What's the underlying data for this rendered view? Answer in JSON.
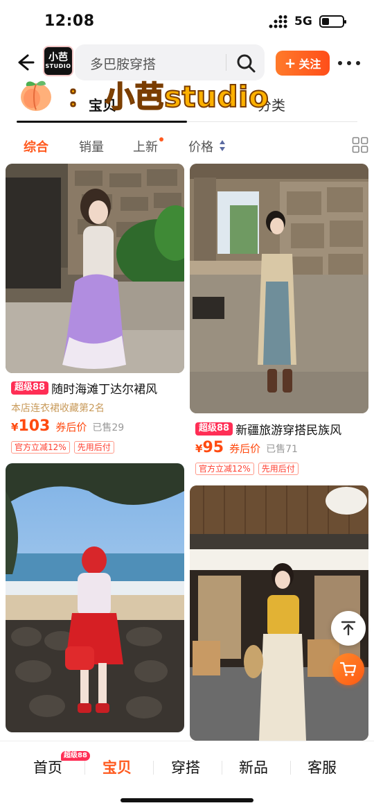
{
  "status_bar": {
    "time": "12:08",
    "network": "5G"
  },
  "header": {
    "shop_logo": {
      "line1": "小芭",
      "line2": "STUDIO"
    },
    "search_text": "多巴胺穿搭",
    "follow_label": "关注",
    "follow_plus": "+"
  },
  "top_tabs": {
    "items": [
      {
        "label": "宝贝"
      },
      {
        "label": "分类"
      }
    ]
  },
  "sticker": {
    "colon": "：",
    "text": "小芭studio"
  },
  "sort_bar": {
    "items": [
      {
        "label": "综合"
      },
      {
        "label": "销量"
      },
      {
        "label": "上新"
      },
      {
        "label": "价格"
      }
    ]
  },
  "products": [
    {
      "badge": "超级88",
      "title": "随时海滩丁达尔裙风",
      "subtitle": "本店连衣裙收藏第2名",
      "currency": "¥",
      "price": "103",
      "price_label": "券后价",
      "sold": "已售29",
      "tags": [
        "官方立减12%",
        "先用后付"
      ]
    },
    {
      "badge": "超级88",
      "title": "新疆旅游穿搭民族风",
      "currency": "¥",
      "price": "95",
      "price_label": "券后价",
      "sold": "已售71",
      "tags": [
        "官方立减12%",
        "先用后付"
      ]
    }
  ],
  "bottom_nav": {
    "badge": "超级88",
    "items": [
      {
        "label": "首页"
      },
      {
        "label": "宝贝"
      },
      {
        "label": "穿搭"
      },
      {
        "label": "新品"
      },
      {
        "label": "客服"
      }
    ]
  },
  "colors": {
    "accent": "#ff5a1f",
    "price": "#ff4a10",
    "badge": "#ff2e55",
    "sticker_fill": "#fdb100",
    "sticker_outline": "#7a3d00"
  },
  "icons": [
    "back-icon",
    "search-icon",
    "more-icon",
    "price-sort-icon",
    "grid-view-icon",
    "back-to-top-icon",
    "cart-icon",
    "peach-icon"
  ]
}
